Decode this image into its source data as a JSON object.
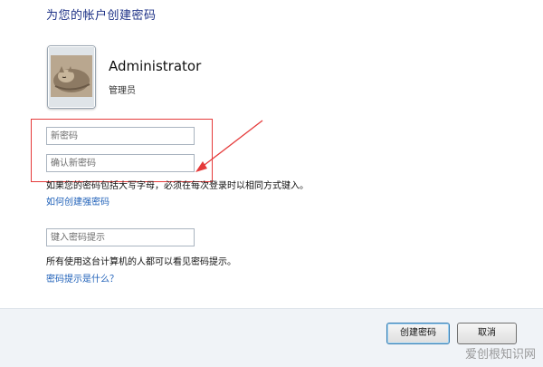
{
  "page": {
    "title": "为您的帐户创建密码"
  },
  "user": {
    "name": "Administrator",
    "role": "管理员",
    "avatar_icon": "cat-avatar-icon"
  },
  "form": {
    "new_password_placeholder": "新密码",
    "confirm_password_placeholder": "确认新密码",
    "case_sensitive_note": "如果您的密码包括大写字母，必须在每次登录时以相同方式键入。",
    "strong_password_link": "如何创建强密码",
    "hint_placeholder": "键入密码提示",
    "hint_note": "所有使用这台计算机的人都可以看见密码提示。",
    "hint_help_link": "密码提示是什么？"
  },
  "buttons": {
    "create_label": "创建密码",
    "cancel_label": "取消"
  },
  "watermark": {
    "text": "爱创根知识网"
  },
  "colors": {
    "title": "#1e3287",
    "link": "#1d5fb8",
    "annotation": "#e53a3a",
    "footer_bg": "#f0f3f7"
  }
}
